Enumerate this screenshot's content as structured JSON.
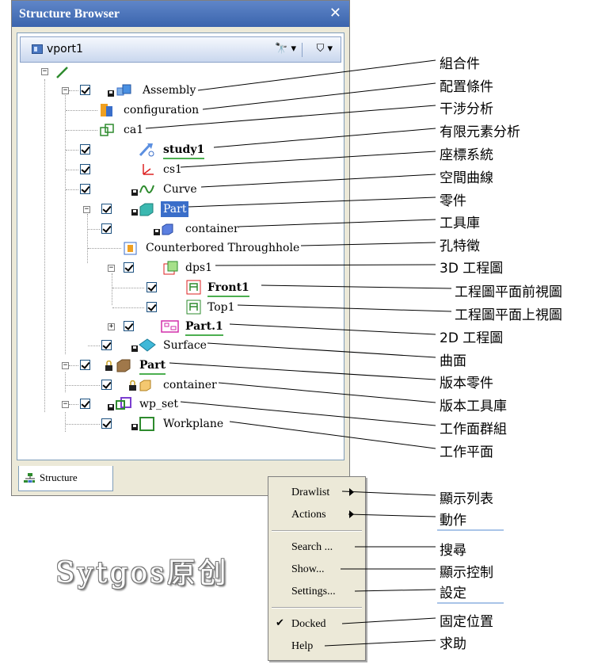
{
  "window": {
    "title": "Structure Browser",
    "close_glyph": "✕"
  },
  "viewport_bar": {
    "label": "vport1",
    "find_glyph": "🔭 ▾",
    "filter_glyph": "⛉ ▾"
  },
  "tree": [
    {
      "label": "Assembly",
      "style": "normal"
    },
    {
      "label": "configuration",
      "style": "normal"
    },
    {
      "label": "ca1",
      "style": "normal"
    },
    {
      "label": "study1",
      "style": "bold-underline"
    },
    {
      "label": "cs1",
      "style": "normal"
    },
    {
      "label": "Curve",
      "style": "normal"
    },
    {
      "label": "Part",
      "style": "selected"
    },
    {
      "label": "container",
      "style": "normal"
    },
    {
      "label": "Counterbored Throughhole",
      "style": "normal"
    },
    {
      "label": "dps1",
      "style": "normal"
    },
    {
      "label": "Front1",
      "style": "bold-underline"
    },
    {
      "label": "Top1",
      "style": "normal"
    },
    {
      "label": "Part.1",
      "style": "bold-underline"
    },
    {
      "label": "Surface",
      "style": "normal"
    },
    {
      "label": "Part",
      "style": "bold-underline"
    },
    {
      "label": "container",
      "style": "normal"
    },
    {
      "label": "wp_set",
      "style": "normal"
    },
    {
      "label": "Workplane",
      "style": "normal"
    }
  ],
  "tab": {
    "label": "Structure"
  },
  "menu": {
    "items": [
      {
        "label": "Drawlist",
        "submenu": true
      },
      {
        "label": "Actions",
        "submenu": true
      },
      {
        "label": "Search ...",
        "submenu": false
      },
      {
        "label": "Show...",
        "submenu": false
      },
      {
        "label": "Settings...",
        "submenu": false
      },
      {
        "label": "Docked",
        "checked": true,
        "check_glyph": "✔"
      },
      {
        "label": "Help",
        "submenu": false
      }
    ]
  },
  "callouts": [
    "組合件",
    "配置條件",
    "干涉分析",
    "有限元素分析",
    "座標系統",
    "空間曲線",
    "零件",
    "工具庫",
    "孔特徵",
    "3D 工程圖",
    "工程圖平面前視圖",
    "工程圖平面上視圖",
    "2D 工程圖",
    "曲面",
    "版本零件",
    "版本工具庫",
    "工作面群組",
    "工作平面"
  ],
  "menu_callouts": [
    "顯示列表",
    "動作",
    "搜尋",
    "顯示控制",
    "設定",
    "固定位置",
    "求助"
  ],
  "watermark": "Sytgos原创",
  "colors": {
    "title_bar": "#3b64ad",
    "selection": "#3a6ec9",
    "accent_green": "#4caf50",
    "menu_bg": "#ece9d8"
  }
}
